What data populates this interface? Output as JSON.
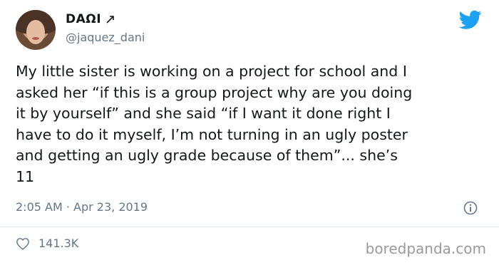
{
  "author": {
    "name": "DAΩI",
    "handle": "@jaquez_dani",
    "avatar": "profile-photo"
  },
  "tweet": {
    "text": "My little sister is working on a project for school and I\nasked her “if this is a group project why are you doing\nit by yourself” and she said “if I want it done right I\nhave to do it myself, I’m not turning in an ugly poster\nand getting an ugly grade because of them”... she’s\n11",
    "timestamp": "2:05 AM · Apr 23, 2019"
  },
  "stats": {
    "likes": "141.3K"
  },
  "icons": {
    "name_badge": "arrow-icon",
    "brand": "twitter-bird-icon",
    "info": "info-icon",
    "like": "heart-icon"
  },
  "colors": {
    "brand": "#1da1f2",
    "secondary_text": "#657786",
    "divider": "#e1e8ed"
  },
  "watermark": "boredpanda.com"
}
